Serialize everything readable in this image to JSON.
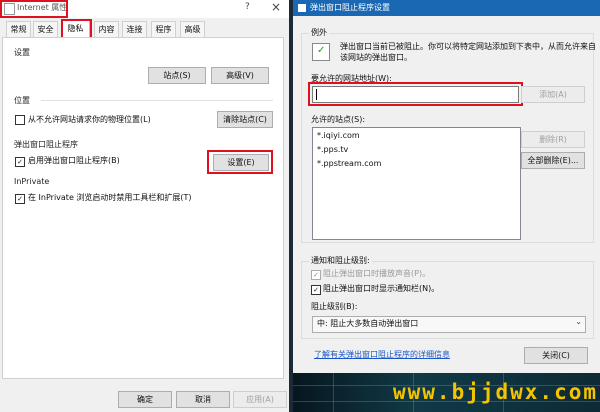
{
  "left": {
    "title": "Internet 属性",
    "help_icon": "?",
    "close_icon": "×",
    "tabs": [
      "常规",
      "安全",
      "隐私",
      "内容",
      "连接",
      "程序",
      "高级"
    ],
    "active_tab": "隐私",
    "settings": {
      "header": "设置",
      "sites_button": "站点(S)",
      "advanced_button": "高级(V)"
    },
    "location": {
      "header": "位置",
      "checkbox_label": "从不允许网站请求你的物理位置(L)",
      "checked": false,
      "clear_button": "清除站点(C)"
    },
    "popup": {
      "header": "弹出窗口阻止程序",
      "checkbox_label": "启用弹出窗口阻止程序(B)",
      "checked": true,
      "settings_button": "设置(E)"
    },
    "inprivate": {
      "header": "InPrivate",
      "checkbox_label": "在 InPrivate 浏览启动时禁用工具栏和扩展(T)",
      "checked": true
    },
    "footer": {
      "ok": "确定",
      "cancel": "取消",
      "apply": "应用(A)"
    }
  },
  "right": {
    "title": "弹出窗口阻止程序设置",
    "exceptions": {
      "header": "例外",
      "desc_line1": "弹出窗口当前已被阻止。你可以将特定网站添加到下表中，从而允许来自",
      "desc_line2": "该网站的弹出窗口。",
      "address_label": "要允许的网站地址(W):",
      "address_value": "",
      "add_button": "添加(A)",
      "allowed_label": "允许的站点(S):",
      "allowed_sites": [
        "*.iqiyi.com",
        "*.pps.tv",
        "*.ppstream.com"
      ],
      "remove_button": "删除(R)",
      "remove_all_button": "全部删除(E)..."
    },
    "notify": {
      "header": "通知和阻止级别:",
      "sound_label": "阻止弹出窗口时播放声音(P)。",
      "sound_checked": true,
      "bar_label": "阻止弹出窗口时显示通知栏(N)。",
      "bar_checked": true,
      "level_label": "阻止级别(B):",
      "level_value": "中: 阻止大多数自动弹出窗口"
    },
    "learn_more_link": "了解有关弹出窗口阻止程序的详细信息",
    "close_button": "关闭(C)"
  },
  "watermark": "www.bjjdwx.com"
}
